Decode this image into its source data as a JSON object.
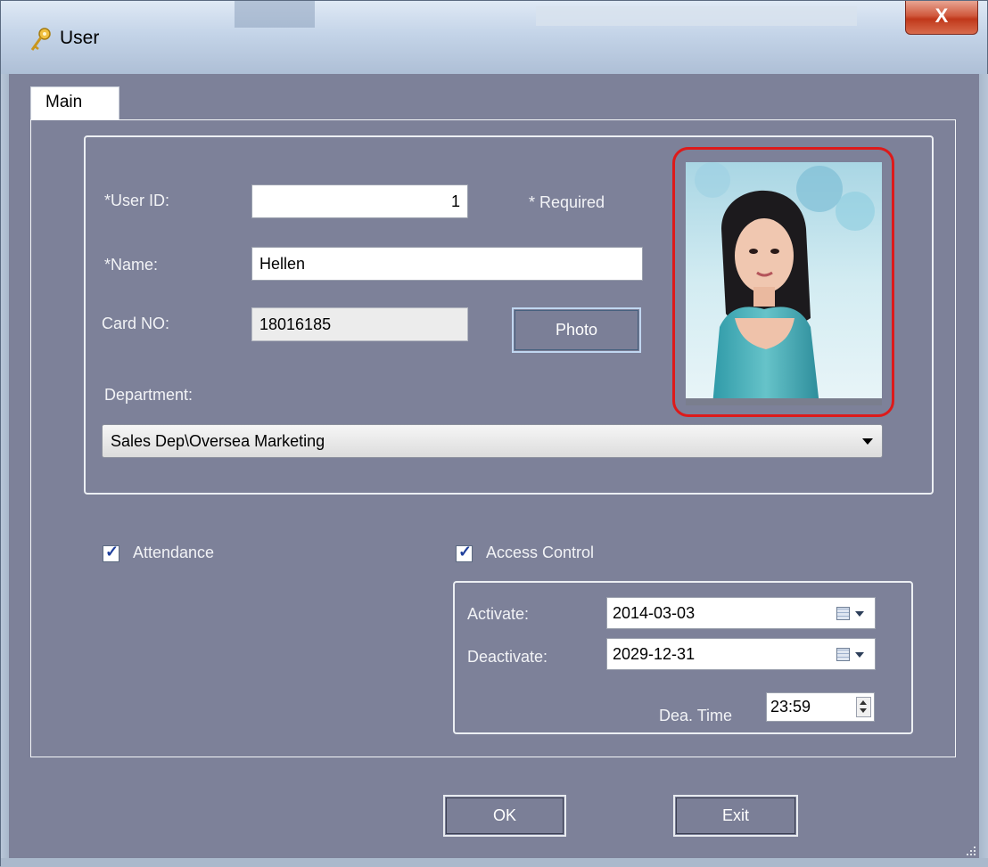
{
  "window": {
    "title": "User",
    "close_label": "X"
  },
  "tabs": [
    {
      "label": "Main",
      "active": true
    }
  ],
  "form": {
    "user_id_label": "*User ID:",
    "user_id_value": "1",
    "required_note": "* Required",
    "name_label": "*Name:",
    "name_value": "Hellen",
    "card_label": "Card NO:",
    "card_value": "18016185",
    "photo_button": "Photo",
    "department_label": "Department:",
    "department_value": "Sales Dep\\Oversea Marketing"
  },
  "options": {
    "attendance_label": "Attendance",
    "attendance_checked": true,
    "access_control_label": "Access Control",
    "access_control_checked": true
  },
  "access": {
    "activate_label": "Activate:",
    "activate_value": "2014-03-03",
    "deactivate_label": "Deactivate:",
    "deactivate_value": "2029-12-31",
    "dea_time_label": "Dea. Time",
    "dea_time_value": "23:59"
  },
  "buttons": {
    "ok": "OK",
    "exit": "Exit"
  },
  "colors": {
    "client_bg": "#7d8199",
    "photo_highlight": "#dd1a1a",
    "close_button": "#c8462a"
  }
}
